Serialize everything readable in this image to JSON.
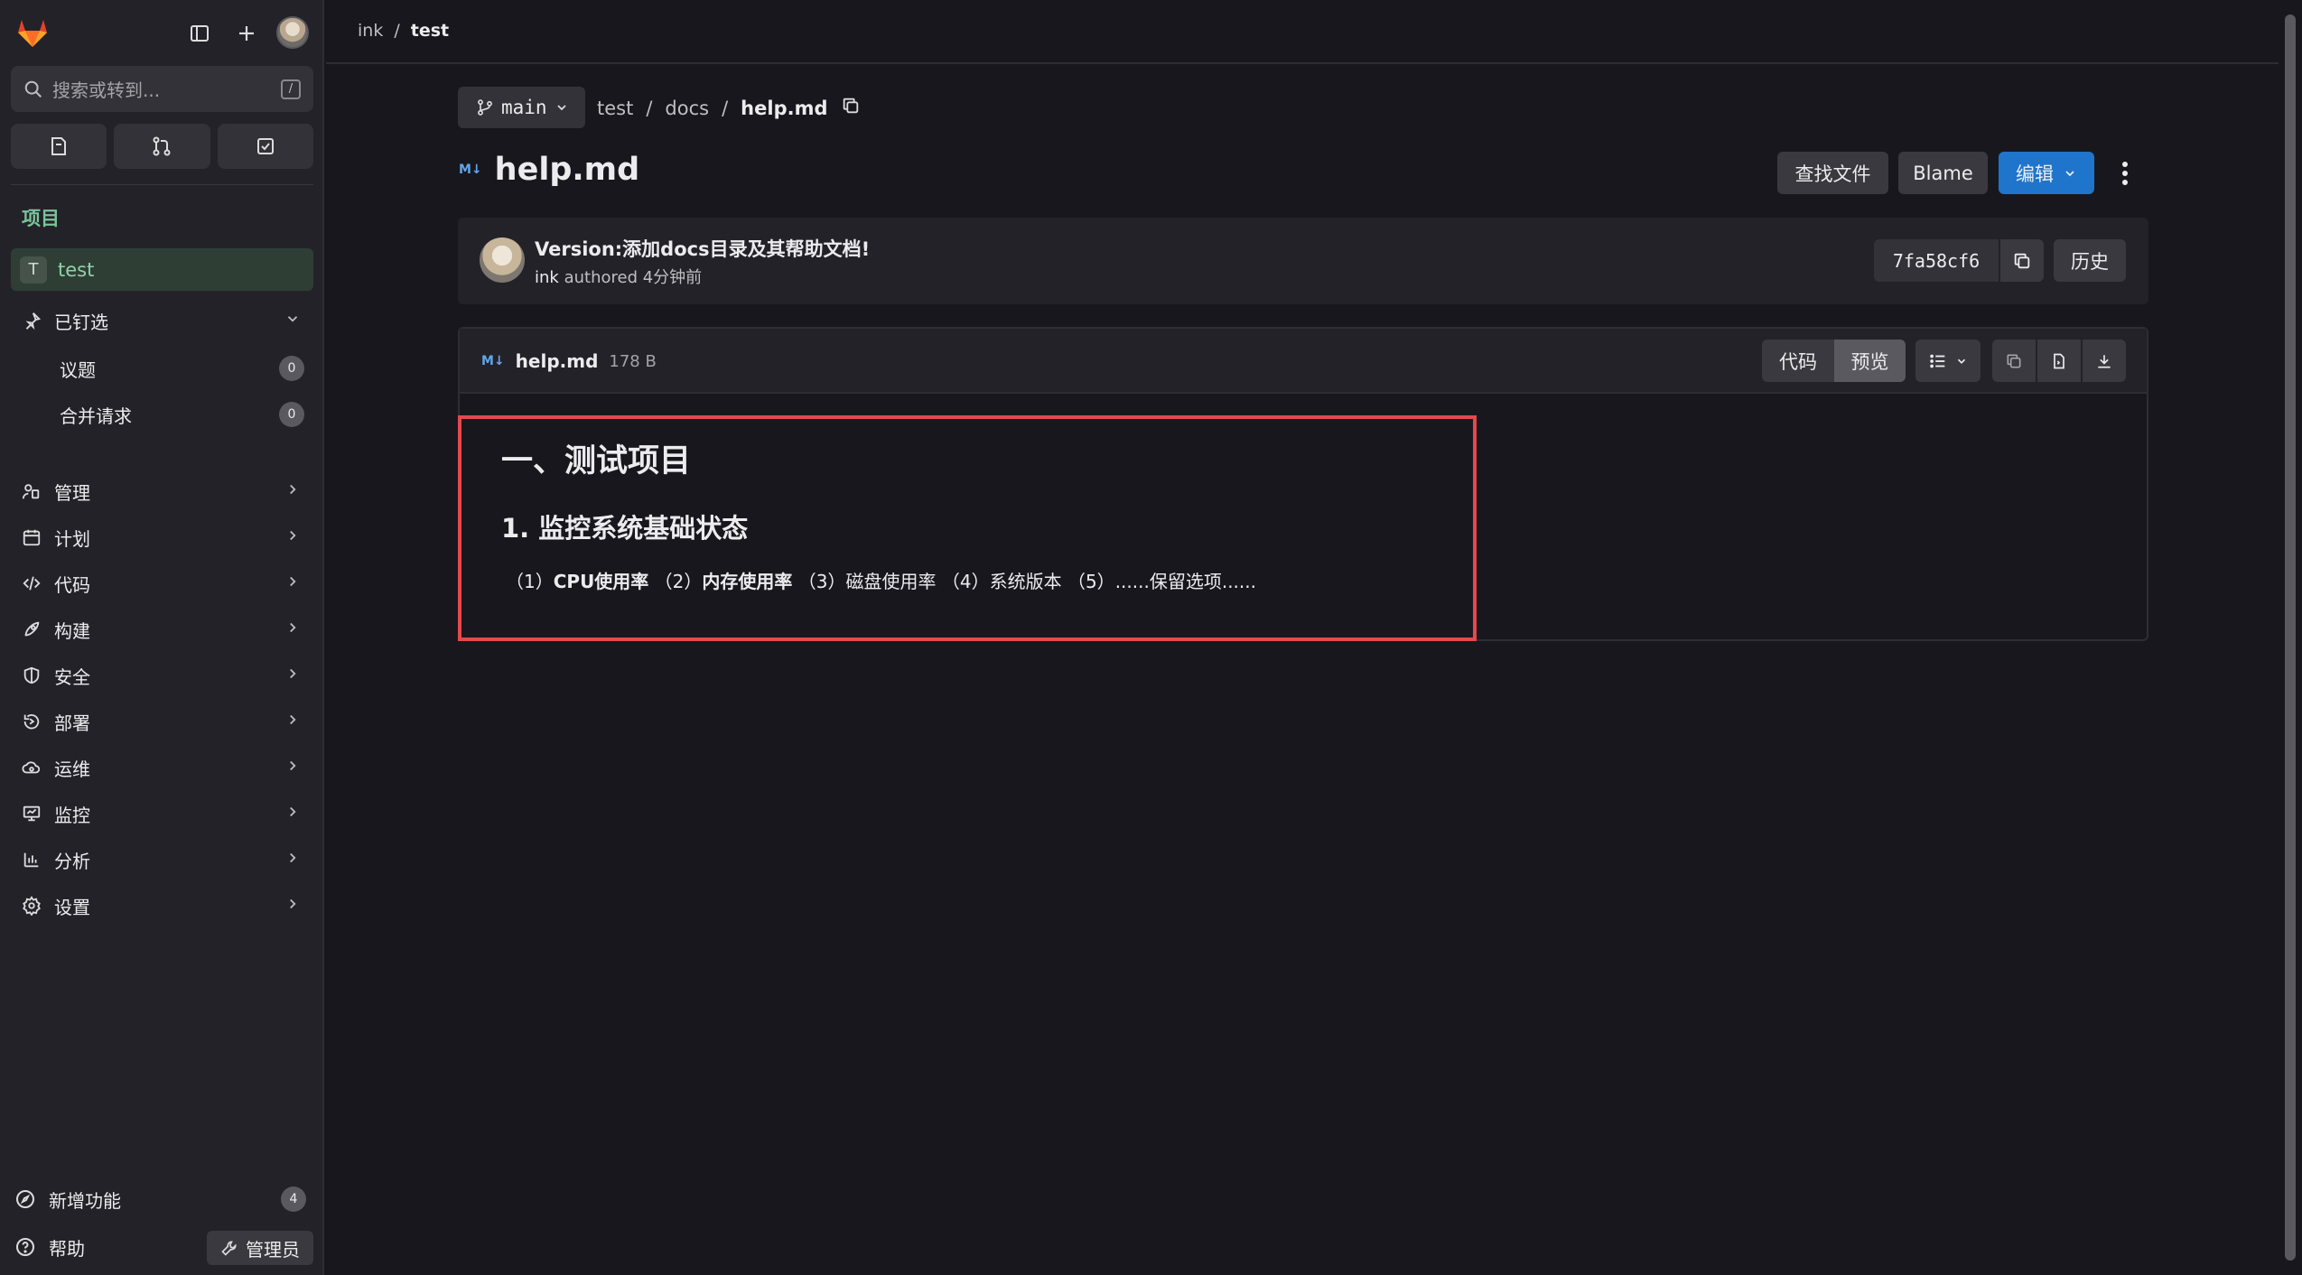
{
  "sidebar": {
    "search_placeholder": "搜索或转到...",
    "search_shortcut": "/",
    "section_title": "项目",
    "project": {
      "avatar_letter": "T",
      "name": "test"
    },
    "pinned": {
      "label": "已钉选",
      "items": [
        {
          "label": "议题",
          "count": "0"
        },
        {
          "label": "合并请求",
          "count": "0"
        }
      ]
    },
    "nav": [
      {
        "label": "管理",
        "icon": "users-icon"
      },
      {
        "label": "计划",
        "icon": "calendar-icon"
      },
      {
        "label": "代码",
        "icon": "code-icon"
      },
      {
        "label": "构建",
        "icon": "rocket-icon"
      },
      {
        "label": "安全",
        "icon": "shield-icon"
      },
      {
        "label": "部署",
        "icon": "deploy-icon"
      },
      {
        "label": "运维",
        "icon": "cloud-icon"
      },
      {
        "label": "监控",
        "icon": "monitor-icon"
      },
      {
        "label": "分析",
        "icon": "chart-icon"
      },
      {
        "label": "设置",
        "icon": "gear-icon"
      }
    ],
    "whats_new": {
      "label": "新增功能",
      "count": "4"
    },
    "help_label": "帮助",
    "admin_label": "管理员"
  },
  "topbar": {
    "breadcrumbs": [
      "ink",
      "/",
      "test"
    ]
  },
  "repo": {
    "branch": "main",
    "path": [
      "test",
      "/",
      "docs",
      "/",
      "help.md"
    ],
    "file_title": "help.md",
    "md_badge": "M↓",
    "buttons": {
      "find_file": "查找文件",
      "blame": "Blame",
      "edit": "编辑"
    }
  },
  "commit": {
    "title": "Version:添加docs目录及其帮助文档!",
    "author": "ink",
    "authored_text": "authored 4分钟前",
    "sha": "7fa58cf6",
    "history_label": "历史"
  },
  "file_viewer": {
    "name": "help.md",
    "size": "178 B",
    "tab_code": "代码",
    "tab_preview": "预览"
  },
  "markdown": {
    "h1": "一、测试项目",
    "h2": "1. 监控系统基础状态",
    "items": [
      {
        "num": "（1）",
        "text": "CPU使用率",
        "bold": true
      },
      {
        "num": "（2）",
        "text": "内存使用率",
        "bold": true
      },
      {
        "num": "（3）",
        "text": "磁盘使用率",
        "bold": false
      },
      {
        "num": "（4）",
        "text": "系统版本",
        "bold": false
      },
      {
        "num": "（5）",
        "text": "......保留选项......",
        "bold": false
      }
    ]
  },
  "colors": {
    "accent": "#1f75cb",
    "highlight_border": "#e5484d",
    "project_active": "#8fd3a9"
  }
}
